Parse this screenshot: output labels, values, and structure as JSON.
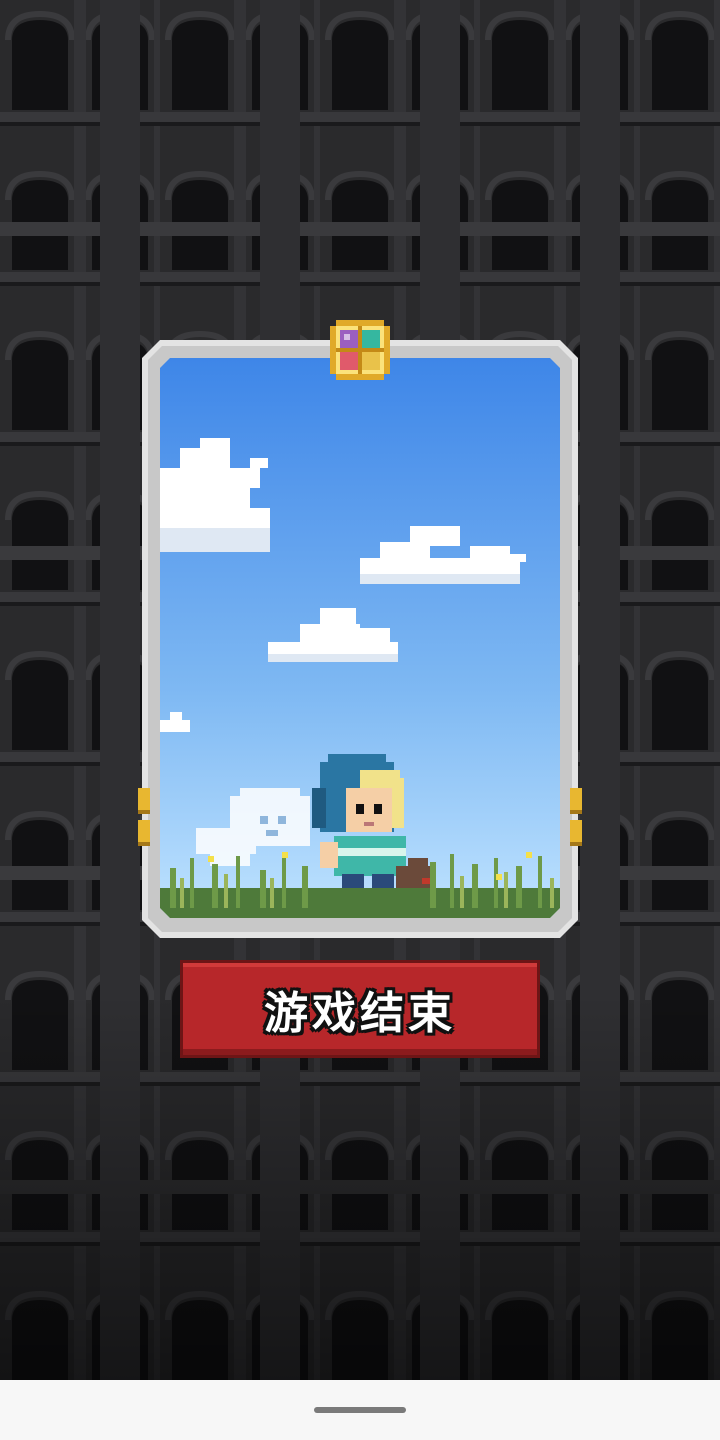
{
  "button": {
    "label": "游戏结束"
  },
  "colors": {
    "background": "#1b1b1d",
    "button_red": "#b7272a",
    "sky_top": "#3e86e8",
    "sky_bottom": "#bfe3ff",
    "card_frame": "#e3e3e3",
    "nav_bar": "#f7f7f7"
  },
  "icons": {
    "gem": "rainbow-gem-icon",
    "home_indicator": "home-indicator"
  }
}
